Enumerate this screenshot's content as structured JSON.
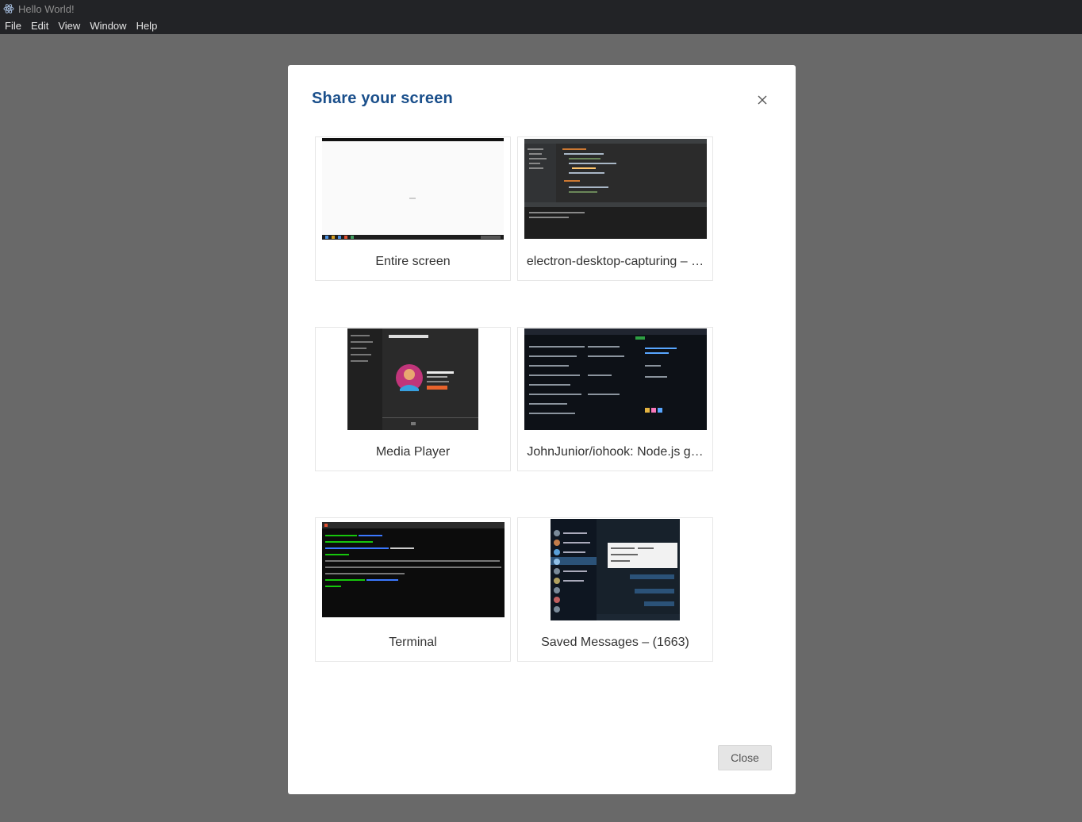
{
  "window": {
    "title": "Hello World!",
    "icon": "electron-atom-icon"
  },
  "menu": {
    "items": [
      "File",
      "Edit",
      "View",
      "Window",
      "Help"
    ]
  },
  "dialog": {
    "title": "Share your screen",
    "close_icon": "close-icon",
    "close_button": "Close",
    "accent_color": "#1a4f8b",
    "sources": [
      {
        "label": "Entire screen",
        "thumbnail": "desktop-preview"
      },
      {
        "label": "electron-desktop-capturing – …",
        "thumbnail": "code-editor-preview"
      },
      {
        "label": "Media Player",
        "thumbnail": "media-player-preview"
      },
      {
        "label": "JohnJunior/iohook: Node.js g…",
        "thumbnail": "browser-github-preview"
      },
      {
        "label": "Terminal",
        "thumbnail": "terminal-preview"
      },
      {
        "label": "Saved Messages – (1663)",
        "thumbnail": "messenger-preview"
      }
    ]
  }
}
